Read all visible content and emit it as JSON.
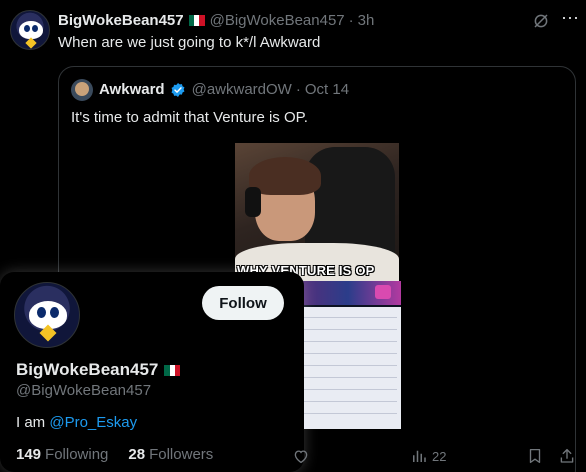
{
  "tweet": {
    "display_name": "BigWokeBean457",
    "handle": "@BigWokeBean457",
    "separator": "·",
    "time": "3h",
    "text": "When are we just going to k*/l Awkward"
  },
  "quote": {
    "display_name": "Awkward",
    "handle": "@awkwardOW",
    "separator": "·",
    "date": "Oct 14",
    "text": "It's time to admit that Venture is OP.",
    "media_caption": "WHY VENTURE IS OP"
  },
  "hover_card": {
    "follow_label": "Follow",
    "display_name": "BigWokeBean457",
    "handle": "@BigWokeBean457",
    "bio_prefix": "I am ",
    "bio_mention": "@Pro_Eskay",
    "following_count": "149",
    "following_label": "Following",
    "followers_count": "28",
    "followers_label": "Followers"
  },
  "actions": {
    "views": "22"
  },
  "icons": [
    "grok-icon",
    "more-icon",
    "verified-icon",
    "like-icon",
    "views-icon",
    "bookmark-icon",
    "share-icon",
    "mexico-flag-icon"
  ],
  "colors": {
    "background": "#000000",
    "text_primary": "#e7e9ea",
    "text_secondary": "#71767b",
    "link": "#1d9bf0",
    "border": "#2f3336",
    "verified": "#1d9bf0"
  }
}
